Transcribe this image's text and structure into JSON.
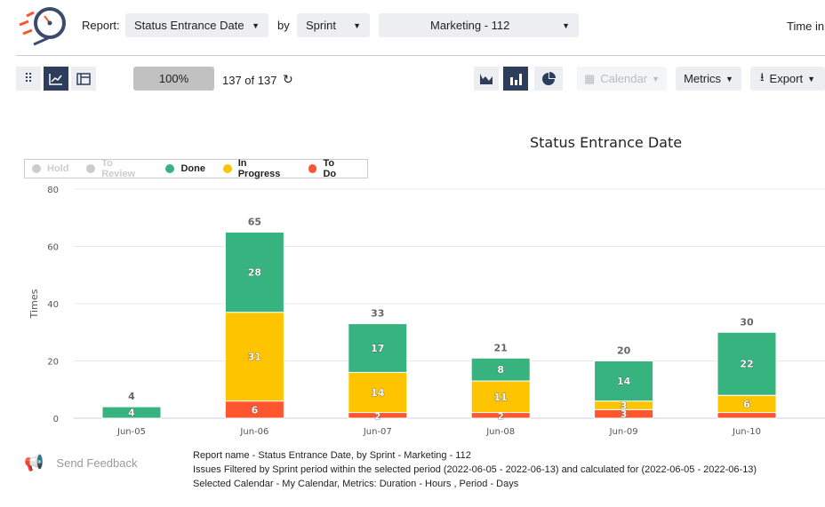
{
  "header": {
    "report_label": "Report:",
    "report_value": "Status Entrance Date",
    "by_label": "by",
    "group_value": "Sprint",
    "sprint_value": "Marketing - 112",
    "time_in": "Time in"
  },
  "toolbar": {
    "zoom": "100%",
    "count": "137 of 137",
    "calendar": "Calendar",
    "metrics": "Metrics",
    "export": "Export"
  },
  "colors": {
    "done": "#36b37e",
    "in_progress": "#ffc400",
    "to_do": "#ff5630",
    "disabled": "#cccccc",
    "dark": "#2d3e5c"
  },
  "chart_data": {
    "type": "bar",
    "stacked": true,
    "title": "Status Entrance Date",
    "ylabel": "Times",
    "xlabel": "",
    "ylim": [
      0,
      80
    ],
    "yticks": [
      0,
      20,
      40,
      60,
      80
    ],
    "grid": true,
    "legend_position": "top-left",
    "legend": [
      {
        "name": "Hold",
        "active": false
      },
      {
        "name": "To Review",
        "active": false
      },
      {
        "name": "Done",
        "active": true
      },
      {
        "name": "In Progress",
        "active": true
      },
      {
        "name": "To Do",
        "active": true
      }
    ],
    "categories": [
      "Jun-05",
      "Jun-06",
      "Jun-07",
      "Jun-08",
      "Jun-09",
      "Jun-10"
    ],
    "series": [
      {
        "name": "To Do",
        "values": [
          0,
          6,
          2,
          2,
          3,
          2
        ]
      },
      {
        "name": "In Progress",
        "values": [
          0,
          31,
          14,
          11,
          3,
          6
        ]
      },
      {
        "name": "Done",
        "values": [
          4,
          28,
          17,
          8,
          14,
          22
        ]
      }
    ],
    "totals": [
      4,
      65,
      33,
      21,
      20,
      30
    ]
  },
  "footer": {
    "feedback": "Send Feedback",
    "line1": "Report name - Status Entrance Date, by Sprint - Marketing - 112",
    "line2": "Issues Filtered by Sprint period within the selected period (2022-06-05 - 2022-06-13) and calculated for (2022-06-05 - 2022-06-13)",
    "line3": "Selected Calendar - My Calendar, Metrics: Duration - Hours , Period - Days"
  }
}
